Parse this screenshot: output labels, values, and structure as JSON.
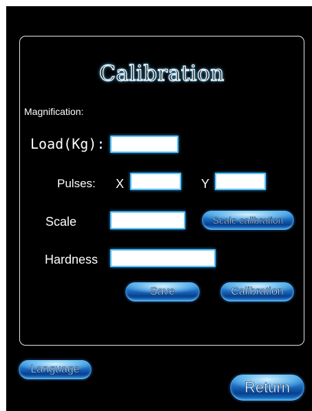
{
  "title": "Calibration",
  "labels": {
    "magnification": "Magnification:",
    "load": "Load(Kg):",
    "pulses": "Pulses:",
    "x": "X",
    "y": "Y",
    "scale": "Scale",
    "hardness": "Hardness"
  },
  "fields": {
    "load": "",
    "pulses_x": "",
    "pulses_y": "",
    "scale": "",
    "hardness": ""
  },
  "buttons": {
    "scale_calibration": "Scale calibration",
    "save": "Save",
    "calibration": "Calibration",
    "language": "Language",
    "return": "Return"
  }
}
